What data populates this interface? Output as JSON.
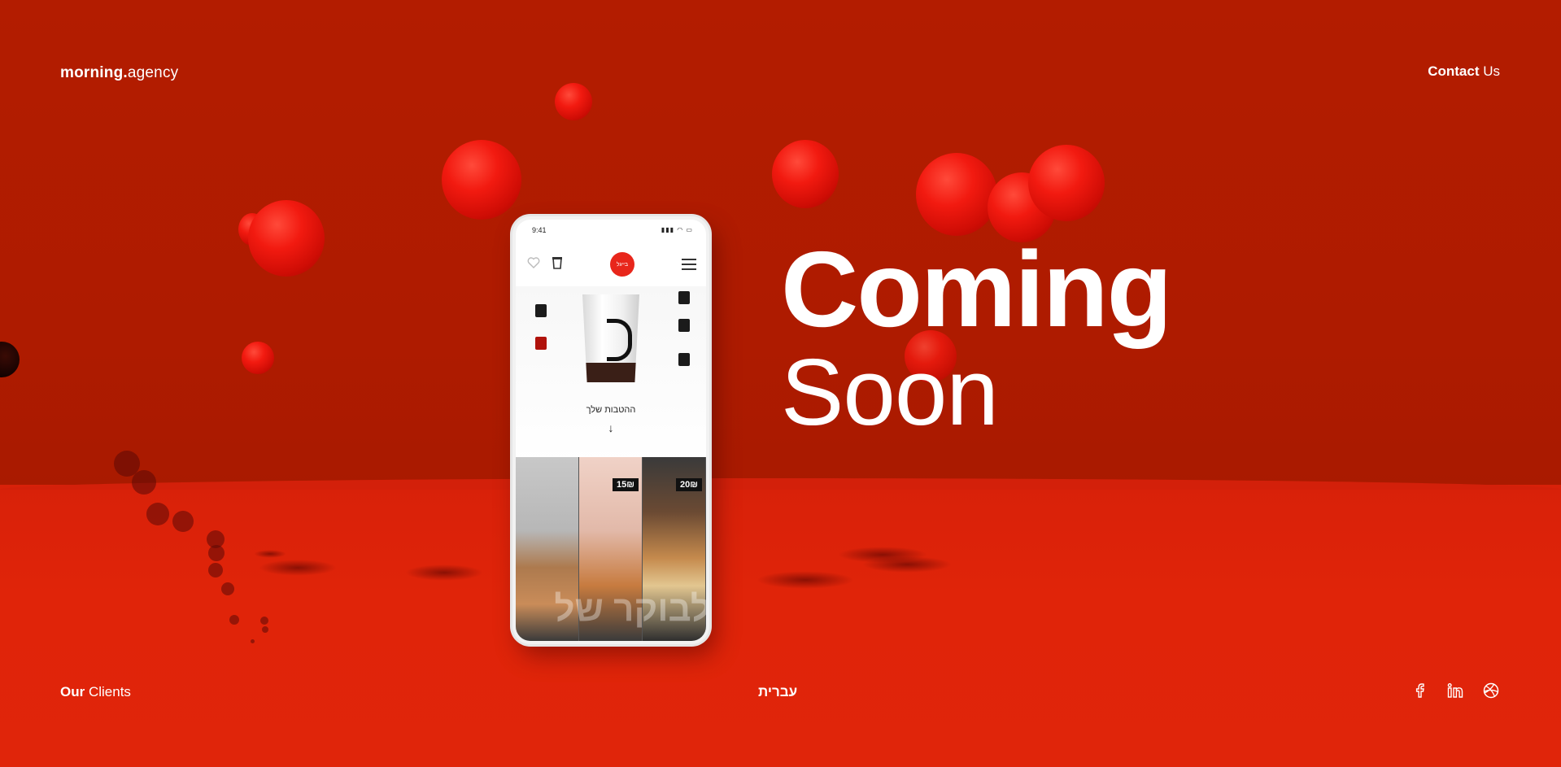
{
  "header": {
    "logo_bold": "morning.",
    "logo_light": "agency",
    "contact_bold": "Contact",
    "contact_light": "Us"
  },
  "headline": {
    "line1": "Coming",
    "line2": "Soon"
  },
  "footer": {
    "clients_bold": "Our",
    "clients_light": "Clients",
    "language": "עברית",
    "socials": [
      "facebook-icon",
      "linkedin-icon",
      "dribbble-icon"
    ]
  },
  "phone": {
    "time": "9:41",
    "status": "▮▮▮ ◠ ▭",
    "brand": "בייגל",
    "caption": "ההטבות שלך",
    "arrow": "↓",
    "prices": [
      "15₪",
      "20₪"
    ],
    "overlay": "לבוקר של"
  },
  "colors": {
    "wall": "#b01a00",
    "floor": "#e0250a",
    "accent": "#e8261b"
  }
}
